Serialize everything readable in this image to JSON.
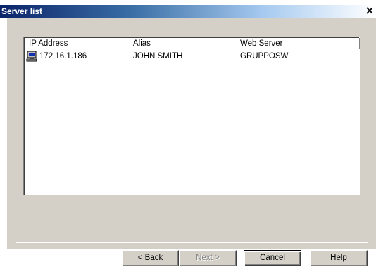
{
  "window": {
    "title": "Server list",
    "close_glyph": "×"
  },
  "list": {
    "columns": [
      "IP Address",
      "Alias",
      "Web Server"
    ],
    "rows": [
      {
        "icon": "computer-icon",
        "ip": "172.16.1.186",
        "alias": "JOHN SMITH",
        "web_server": "GRUPPOSW"
      }
    ]
  },
  "buttons": {
    "back": "< Back",
    "next": "Next >",
    "cancel": "Cancel",
    "help": "Help"
  },
  "colors": {
    "title_bar_start": "#0a246a",
    "dialog_face": "#d4d0c8",
    "list_background": "#ffffff"
  }
}
